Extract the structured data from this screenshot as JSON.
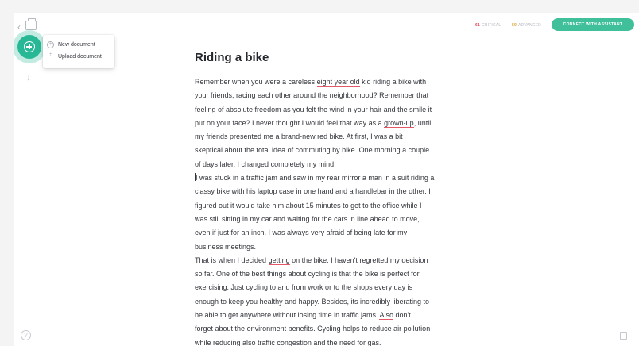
{
  "toolbar": {
    "critical_count": "61",
    "critical_label": "CRITICAL",
    "advanced_count": "59",
    "advanced_label": "ADVANCED",
    "assistant_button": "CONNECT WITH ASSISTANT"
  },
  "menu": {
    "new_document": "New document",
    "upload_document": "Upload document"
  },
  "document": {
    "title": "Riding a bike",
    "lines": [
      [
        {
          "t": "Remember when you were a careless "
        },
        {
          "t": "eight year old",
          "flag": true
        },
        {
          "t": " kid riding a bike with"
        }
      ],
      [
        {
          "t": "your friends, racing each other around the neighborhood? Remember that"
        }
      ],
      [
        {
          "t": "feeling of absolute freedom as you felt the wind in your hair and the smile it"
        }
      ],
      [
        {
          "t": "put on your face? I never thought I would feel that way as a "
        },
        {
          "t": "grown-up",
          "flag": true
        },
        {
          "t": ", until"
        }
      ],
      [
        {
          "t": "my friends presented me a brand-new red bike. At first, I was a bit"
        }
      ],
      [
        {
          "t": "skeptical about the total idea of commuting by bike. One morning a couple"
        }
      ],
      [
        {
          "t": "of days later, I changed completely my mind."
        }
      ],
      [
        {
          "cursor": true
        },
        {
          "t": "I was stuck in a traffic jam and saw in my rear mirror a man in a suit riding a"
        }
      ],
      [
        {
          "t": "classy bike with his laptop case in one hand and a handlebar in the other. I"
        }
      ],
      [
        {
          "t": "figured out it would take him about 15 minutes to get to the office while I"
        }
      ],
      [
        {
          "t": "was still sitting in my car and waiting for the cars in line ahead to move,"
        }
      ],
      [
        {
          "t": "even if just for an inch. I was always very afraid of being late for my"
        }
      ],
      [
        {
          "t": "business meetings."
        }
      ],
      [
        {
          "t": "That is when I decided "
        },
        {
          "t": "getting",
          "flag": true
        },
        {
          "t": " on the bike. I haven't regretted my decision"
        }
      ],
      [
        {
          "t": "so far. One of the best things about cycling is that the bike is perfect for"
        }
      ],
      [
        {
          "t": "exercising. Just cycling to and from work or to the shops every day is"
        }
      ],
      [
        {
          "t": "enough to keep you healthy and happy. Besides, "
        },
        {
          "t": "its",
          "flag": true
        },
        {
          "t": " incredibly liberating to"
        }
      ],
      [
        {
          "t": "be able to get anywhere without losing time in traffic jams. "
        },
        {
          "t": "Also",
          "flag": true
        },
        {
          "t": " don't"
        }
      ],
      [
        {
          "t": "forget about the "
        },
        {
          "t": "environment",
          "flag": true
        },
        {
          "t": " benefits. Cycling helps to reduce air pollution"
        }
      ],
      [
        {
          "t": "while reducing also traffic congestion and the need for gas."
        }
      ]
    ]
  },
  "colors": {
    "accent": "#3fbf9a",
    "critical": "#e04a5a",
    "advanced": "#d8a936",
    "flag_underline": "#e25866"
  },
  "icons": {
    "back": "chevron-left-icon",
    "documents": "documents-icon",
    "add": "plus-circle-icon",
    "download": "download-icon",
    "new_doc": "plus-circle-icon",
    "upload": "upload-icon",
    "help": "help-icon",
    "doc_stats": "document-stats-icon"
  }
}
